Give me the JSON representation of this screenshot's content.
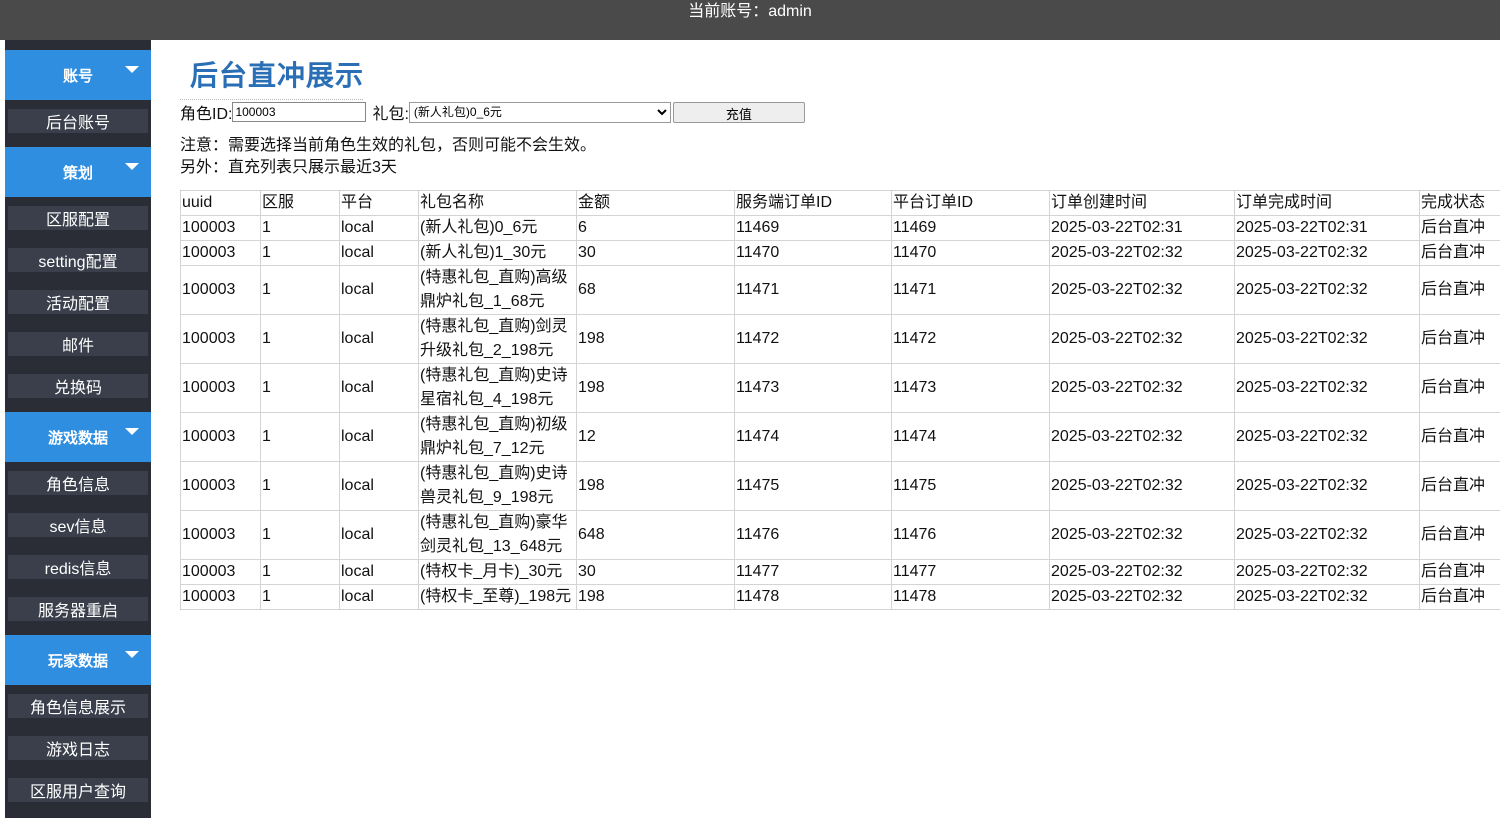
{
  "topbar": {
    "account_text": "当前账号：admin"
  },
  "sidebar": {
    "groups": [
      {
        "label": "账号",
        "items": [
          {
            "label": "后台账号"
          }
        ]
      },
      {
        "label": "策划",
        "items": [
          {
            "label": "区服配置"
          },
          {
            "label": "setting配置"
          },
          {
            "label": "活动配置"
          },
          {
            "label": "邮件"
          },
          {
            "label": "兑换码"
          }
        ]
      },
      {
        "label": "游戏数据",
        "items": [
          {
            "label": "角色信息"
          },
          {
            "label": "sev信息"
          },
          {
            "label": "redis信息"
          },
          {
            "label": "服务器重启"
          }
        ]
      },
      {
        "label": "玩家数据",
        "items": [
          {
            "label": "角色信息展示"
          },
          {
            "label": "游戏日志"
          },
          {
            "label": "区服用户查询"
          }
        ]
      }
    ]
  },
  "main": {
    "title": "后台直冲展示",
    "form": {
      "role_label": "角色ID:",
      "role_value": "100003",
      "gift_label": "礼包:",
      "gift_selected": "(新人礼包)0_6元",
      "submit_label": "充值"
    },
    "notes": [
      "注意：需要选择当前角色生效的礼包，否则可能不会生效。",
      "另外：直充列表只展示最近3天"
    ],
    "table": {
      "headers": [
        "uuid",
        "区服",
        "平台",
        "礼包名称",
        "金额",
        "服务端订单ID",
        "平台订单ID",
        "订单创建时间",
        "订单完成时间",
        "完成状态"
      ],
      "rows": [
        [
          "100003",
          "1",
          "local",
          "(新人礼包)0_6元",
          "6",
          "11469",
          "11469",
          "2025-03-22T02:31",
          "2025-03-22T02:31",
          "后台直冲"
        ],
        [
          "100003",
          "1",
          "local",
          "(新人礼包)1_30元",
          "30",
          "11470",
          "11470",
          "2025-03-22T02:32",
          "2025-03-22T02:32",
          "后台直冲"
        ],
        [
          "100003",
          "1",
          "local",
          "(特惠礼包_直购)高级鼎炉礼包_1_68元",
          "68",
          "11471",
          "11471",
          "2025-03-22T02:32",
          "2025-03-22T02:32",
          "后台直冲"
        ],
        [
          "100003",
          "1",
          "local",
          "(特惠礼包_直购)剑灵升级礼包_2_198元",
          "198",
          "11472",
          "11472",
          "2025-03-22T02:32",
          "2025-03-22T02:32",
          "后台直冲"
        ],
        [
          "100003",
          "1",
          "local",
          "(特惠礼包_直购)史诗星宿礼包_4_198元",
          "198",
          "11473",
          "11473",
          "2025-03-22T02:32",
          "2025-03-22T02:32",
          "后台直冲"
        ],
        [
          "100003",
          "1",
          "local",
          "(特惠礼包_直购)初级鼎炉礼包_7_12元",
          "12",
          "11474",
          "11474",
          "2025-03-22T02:32",
          "2025-03-22T02:32",
          "后台直冲"
        ],
        [
          "100003",
          "1",
          "local",
          "(特惠礼包_直购)史诗兽灵礼包_9_198元",
          "198",
          "11475",
          "11475",
          "2025-03-22T02:32",
          "2025-03-22T02:32",
          "后台直冲"
        ],
        [
          "100003",
          "1",
          "local",
          "(特惠礼包_直购)豪华剑灵礼包_13_648元",
          "648",
          "11476",
          "11476",
          "2025-03-22T02:32",
          "2025-03-22T02:32",
          "后台直冲"
        ],
        [
          "100003",
          "1",
          "local",
          "(特权卡_月卡)_30元",
          "30",
          "11477",
          "11477",
          "2025-03-22T02:32",
          "2025-03-22T02:32",
          "后台直冲"
        ],
        [
          "100003",
          "1",
          "local",
          "(特权卡_至尊)_198元",
          "198",
          "11478",
          "11478",
          "2025-03-22T02:32",
          "2025-03-22T02:32",
          "后台直冲"
        ]
      ]
    }
  }
}
